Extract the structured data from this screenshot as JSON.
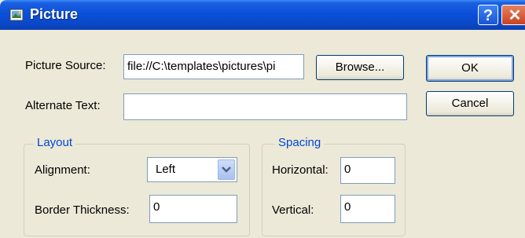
{
  "window": {
    "title": "Picture",
    "help_glyph": "?",
    "close_glyph": "✕"
  },
  "labels": {
    "picture_source": "Picture Source:",
    "alternate_text": "Alternate Text:",
    "alignment": "Alignment:",
    "border_thickness": "Border Thickness:",
    "horizontal": "Horizontal:",
    "vertical": "Vertical:"
  },
  "fields": {
    "picture_source_value": "file://C:\\templates\\pictures\\pi",
    "alternate_text_value": "",
    "alignment_value": "Left",
    "border_thickness_value": "0",
    "horizontal_value": "0",
    "vertical_value": "0"
  },
  "buttons": {
    "browse": "Browse...",
    "ok": "OK",
    "cancel": "Cancel"
  },
  "groups": {
    "layout": "Layout",
    "spacing": "Spacing"
  },
  "colors": {
    "title_bar": "#0a4fd8",
    "group_legend": "#0046d5",
    "dialog_bg": "#ece9d8"
  },
  "icons": {
    "app": "picture-dialog-icon",
    "help": "help-icon",
    "close": "close-icon",
    "dropdown": "chevron-down-icon"
  }
}
